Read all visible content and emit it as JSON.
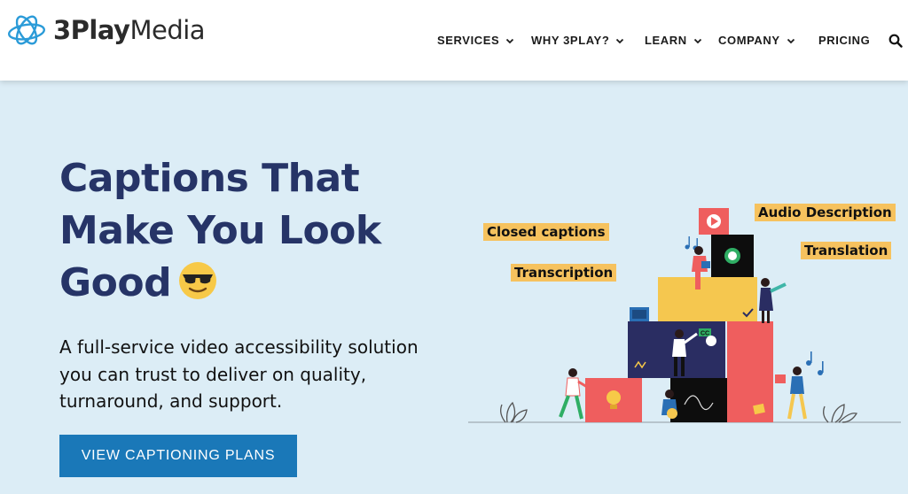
{
  "brand": {
    "name_bold": "3Play",
    "name_regular": "Media"
  },
  "nav": {
    "items": [
      {
        "label": "SERVICES",
        "has_dropdown": true
      },
      {
        "label": "WHY 3PLAY?",
        "has_dropdown": true
      },
      {
        "label": "LEARN",
        "has_dropdown": true
      },
      {
        "label": "COMPANY",
        "has_dropdown": true
      },
      {
        "label": "PRICING",
        "has_dropdown": false
      }
    ],
    "search_icon": "search-icon"
  },
  "hero": {
    "title_lines": [
      "Captions That",
      "Make You Look",
      "Good"
    ],
    "title_emoji": "smiling-face-with-sunglasses",
    "subtitle": "A full-service video accessibility solution you can trust to deliver on quality, turnaround, and support.",
    "cta_label": "VIEW CAPTIONING PLANS"
  },
  "illustration": {
    "tags": {
      "closed_captions": "Closed captions",
      "audio_description": "Audio Description",
      "translation": "Translation",
      "transcription": "Transcription"
    },
    "cc_badge": "CC"
  },
  "colors": {
    "brand_blue": "#1a78b8",
    "title_navy": "#263467",
    "hero_bg": "#dcedf6",
    "tag_yellow": "#f6c25e",
    "block_red": "#ef5e5e",
    "block_yellow": "#f5c74f",
    "block_dark": "#0d0d0d",
    "block_navy": "#2a2d62"
  }
}
